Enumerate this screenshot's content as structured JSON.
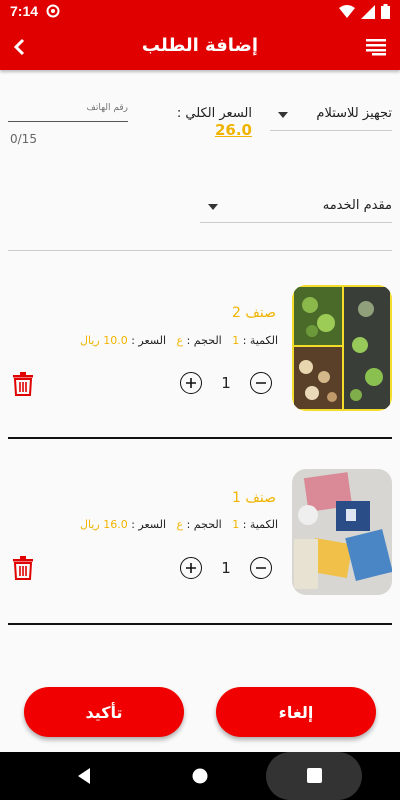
{
  "status_bar": {
    "time": "7:14"
  },
  "app_bar": {
    "title": "إضافة الطلب"
  },
  "form": {
    "phone_placeholder": "رقم الهاتف",
    "phone_counter": "0/15",
    "total_label": "السعر الكلي :",
    "total_value": "26.0",
    "pickup_option": "تجهيز للاستلام",
    "provider_label": "مقدم الخدمه"
  },
  "items": [
    {
      "name": "صنف 2",
      "qty_label": "الكمية :",
      "qty_value": "1",
      "size_label": "الحجم :",
      "size_value": "ع",
      "price_label": "السعر :",
      "price_value": "10.0 ريال",
      "count": "1"
    },
    {
      "name": "صنف 1",
      "qty_label": "الكمية :",
      "qty_value": "1",
      "size_label": "الحجم :",
      "size_value": "ع",
      "price_label": "السعر :",
      "price_value": "16.0 ريال",
      "count": "1"
    }
  ],
  "actions": {
    "confirm_label": "تأكيد",
    "cancel_label": "إلغاء"
  },
  "icons": [
    "at-icon",
    "wifi-icon",
    "signal-icon",
    "battery-icon",
    "back-arrow-icon",
    "menu-icon",
    "plus-icon",
    "minus-icon",
    "trash-icon",
    "nav-back-icon",
    "nav-home-icon",
    "nav-recents-icon"
  ],
  "colors": {
    "primary": "#e00000",
    "accent": "#f0b400"
  }
}
